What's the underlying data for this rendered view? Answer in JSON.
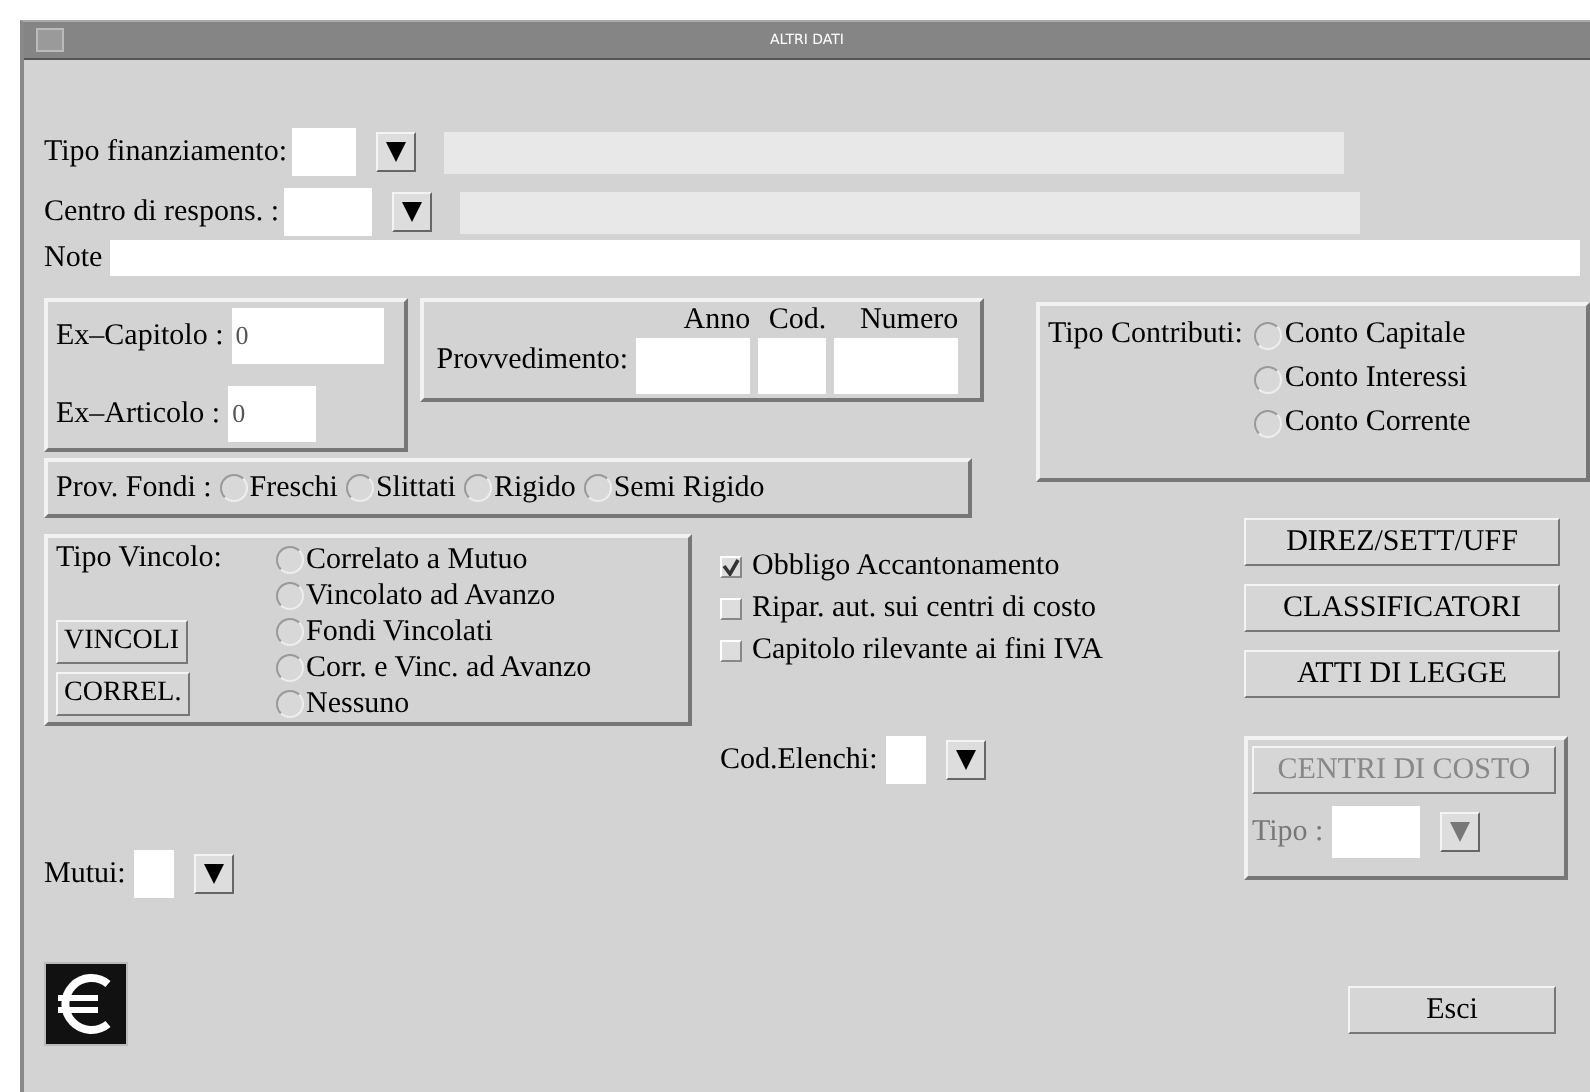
{
  "window": {
    "title": "ALTRI DATI"
  },
  "tipo_finanziamento": {
    "label": "Tipo finanziamento:"
  },
  "centro_respons": {
    "label": "Centro di respons. :"
  },
  "note": {
    "label": "Note"
  },
  "ex_capitolo": {
    "label": "Ex–Capitolo :",
    "value": "0"
  },
  "ex_articolo": {
    "label": "Ex–Articolo :",
    "value": "0"
  },
  "provvedimento": {
    "label": "Provvedimento:",
    "columns": [
      "Anno",
      "Cod.",
      "Numero"
    ]
  },
  "tipo_contributi": {
    "label": "Tipo Contributi:",
    "options": [
      {
        "label": "Conto Capitale",
        "selected": false
      },
      {
        "label": "Conto Interessi",
        "selected": false
      },
      {
        "label": "Conto Corrente",
        "selected": false
      }
    ]
  },
  "prov_fondi": {
    "label": "Prov. Fondi :",
    "options": [
      {
        "label": "Freschi",
        "selected": false
      },
      {
        "label": "Slittati",
        "selected": false
      },
      {
        "label": "Rigido",
        "selected": false
      },
      {
        "label": "Semi Rigido",
        "selected": false
      }
    ]
  },
  "tipo_vincolo": {
    "label": "Tipo Vincolo:",
    "buttons": [
      "VINCOLI",
      "CORREL."
    ],
    "options": [
      {
        "label": "Correlato a Mutuo",
        "selected": false
      },
      {
        "label": "Vincolato ad Avanzo",
        "selected": false
      },
      {
        "label": "Fondi Vincolati",
        "selected": false
      },
      {
        "label": "Corr. e Vinc. ad Avanzo",
        "selected": false
      },
      {
        "label": "Nessuno",
        "selected": false
      }
    ]
  },
  "checkboxes": [
    {
      "label": "Obbligo Accantonamento",
      "checked": true
    },
    {
      "label": "Ripar. aut. sui centri di costo",
      "checked": false
    },
    {
      "label": "Capitolo rilevante ai fini IVA",
      "checked": false
    }
  ],
  "cod_elenchi": {
    "label": "Cod.Elenchi:"
  },
  "mutui": {
    "label": "Mutui:"
  },
  "actions": [
    "DIREZ/SETT/UFF",
    "CLASSIFICATORI",
    "ATTI DI LEGGE"
  ],
  "centri_di_costo": {
    "button": "CENTRI DI COSTO",
    "tipo_label": "Tipo :",
    "disabled": true
  },
  "exit_button": "Esci"
}
